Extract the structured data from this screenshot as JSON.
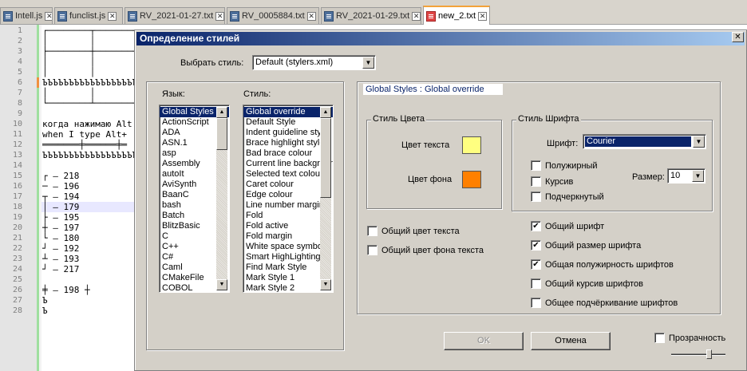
{
  "tabs": [
    {
      "label": "Intell.js",
      "active": false
    },
    {
      "label": "funclist.js",
      "active": false
    },
    {
      "label": "RV_2021-01-27.txt",
      "active": false
    },
    {
      "label": "RV_0005884.txt",
      "active": false
    },
    {
      "label": "RV_2021-01-29.txt",
      "active": false
    },
    {
      "label": "new_2.txt",
      "active": true
    }
  ],
  "editor": {
    "line_numbers": [
      "1",
      "2",
      "3",
      "4",
      "5",
      "6",
      "7",
      "8",
      "9",
      "10",
      "11",
      "12",
      "13",
      "14",
      "15",
      "16",
      "17",
      "18",
      "19",
      "20",
      "21",
      "22",
      "23",
      "24",
      "25",
      "26",
      "27",
      "28"
    ],
    "lines": [
      "┌────────┬───────┐",
      "│        │       │",
      "├────────┼───────┤",
      "│        │       │",
      "│        │       │",
      "ЪЪЪЪЪЪЪЪЪЪЪЪЪЪЪЪЪЪ",
      "│        │       │",
      "└────────┴───────┘",
      "",
      "когда нажимаю Alt",
      "when I type Alt+",
      "═══════╪══════╪═",
      "ЪЪЪЪЪЪЪЪЪЪЪЪЪЪЪЪЪЪ",
      "",
      "┌ – 218",
      "─ – 196",
      "┬ – 194",
      "│ – 179",
      "├ – 195",
      "┼ – 197",
      "└ – 180",
      "┘ – 192",
      "┴ – 193",
      "┘ – 217",
      "",
      "╪ – 198 ┼",
      "Ъ",
      "Ъ"
    ]
  },
  "dialog": {
    "title": "Определение стилей",
    "close_glyph": "✕",
    "select_style_label": "Выбрать стиль:",
    "select_style_value": "Default (stylers.xml)",
    "language_label": "Язык:",
    "style_label": "Стиль:",
    "languages": [
      "Global Styles",
      "ActionScript",
      "ADA",
      "ASN.1",
      "asp",
      "Assembly",
      "autoIt",
      "AviSynth",
      "BaanC",
      "bash",
      "Batch",
      "BlitzBasic",
      "C",
      "C++",
      "C#",
      "Caml",
      "CMakeFile",
      "COBOL"
    ],
    "selected_language": "Global Styles",
    "styles": [
      "Global override",
      "Default Style",
      "Indent guideline style",
      "Brace highlight style",
      "Bad brace colour",
      "Current line background",
      "Selected text colour",
      "Caret colour",
      "Edge colour",
      "Line number margin",
      "Fold",
      "Fold active",
      "Fold margin",
      "White space symbol",
      "Smart HighLighting",
      "Find Mark Style",
      "Mark Style 1",
      "Mark Style 2"
    ],
    "selected_style": "Global override",
    "header_text": "Global Styles : Global override",
    "color_group_title": "Стиль Цвета",
    "text_color_label": "Цвет текста",
    "bg_color_label": "Цвет фона",
    "text_color": "#ffff80",
    "bg_color": "#ff8000",
    "font_group_title": "Стиль Шрифта",
    "font_label": "Шрифт:",
    "font_value": "Courier",
    "bold_label": "Полужирный",
    "italic_label": "Курсив",
    "underline_label": "Подчеркнутый",
    "size_label": "Размер:",
    "size_value": "10",
    "global_fg_label": "Общий цвет текста",
    "global_bg_label": "Общий цвет фона текста",
    "global_font_label": "Общий шрифт",
    "global_font_size_label": "Общий размер шрифта",
    "global_bold_label": "Общая полужирность шрифтов",
    "global_italic_label": "Общий курсив шрифтов",
    "global_underline_label": "Общее подчёркивание шрифтов",
    "global_font_checked": true,
    "global_font_size_checked": true,
    "global_bold_checked": true,
    "ok_label": "OK",
    "cancel_label": "Отмена",
    "transparency_label": "Прозрачность"
  }
}
